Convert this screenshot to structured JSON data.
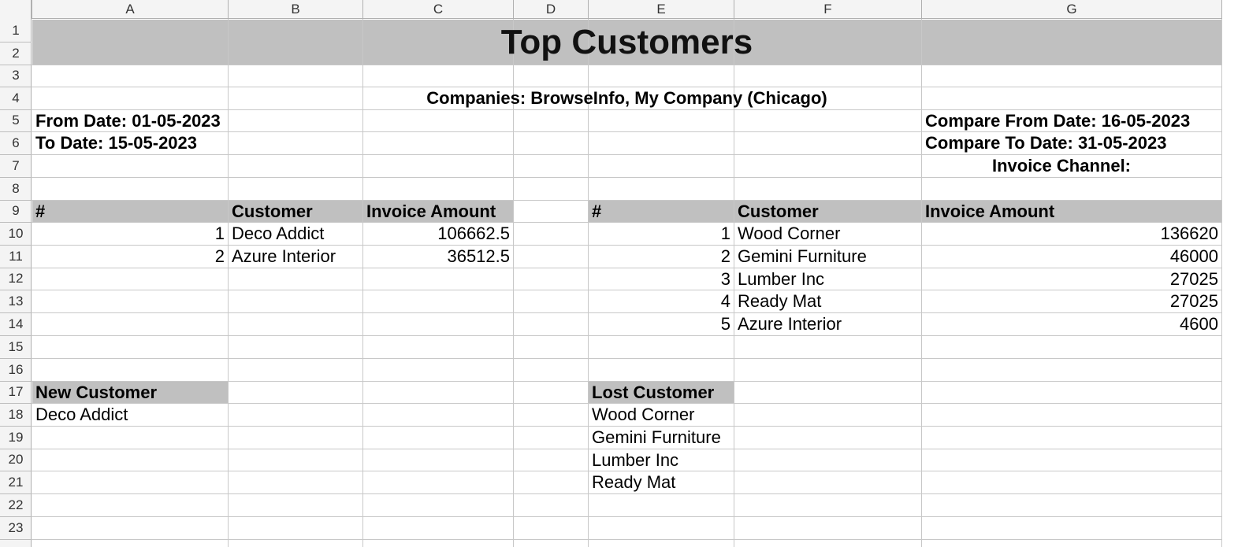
{
  "columns": [
    "A",
    "B",
    "C",
    "D",
    "E",
    "F",
    "G"
  ],
  "rows": [
    "1",
    "2",
    "3",
    "4",
    "5",
    "6",
    "7",
    "8",
    "9",
    "10",
    "11",
    "12",
    "13",
    "14",
    "15",
    "16",
    "17",
    "18",
    "19",
    "20",
    "21",
    "22",
    "23"
  ],
  "report": {
    "title": "Top Customers",
    "companies": "Companies: BrowseInfo, My Company (Chicago)",
    "from_date": "From Date: 01-05-2023",
    "to_date": "To Date: 15-05-2023",
    "compare_from_date": "Compare From Date: 16-05-2023",
    "compare_to_date": "Compare To Date: 31-05-2023",
    "invoice_channel": "Invoice Channel:"
  },
  "left_table": {
    "headers": [
      "#",
      "Customer",
      "Invoice Amount"
    ],
    "rows": [
      {
        "num": "1",
        "customer": "Deco Addict",
        "amount": "106662.5"
      },
      {
        "num": "2",
        "customer": "Azure Interior",
        "amount": "36512.5"
      }
    ]
  },
  "right_table": {
    "headers": [
      "#",
      "Customer",
      "Invoice Amount"
    ],
    "rows": [
      {
        "num": "1",
        "customer": "Wood Corner",
        "amount": "136620"
      },
      {
        "num": "2",
        "customer": "Gemini Furniture",
        "amount": "46000"
      },
      {
        "num": "3",
        "customer": "Lumber Inc",
        "amount": "27025"
      },
      {
        "num": "4",
        "customer": "Ready Mat",
        "amount": "27025"
      },
      {
        "num": "5",
        "customer": "Azure Interior",
        "amount": "4600"
      }
    ]
  },
  "new_customer": {
    "header": "New Customer",
    "items": [
      "Deco Addict"
    ]
  },
  "lost_customer": {
    "header": "Lost Customer",
    "items": [
      "Wood Corner",
      "Gemini Furniture",
      "Lumber Inc",
      "Ready Mat"
    ]
  },
  "colors": {
    "header_fill": "#c0c0c0",
    "gridline": "#c8c8c8",
    "header_bar": "#f4f4f4"
  }
}
